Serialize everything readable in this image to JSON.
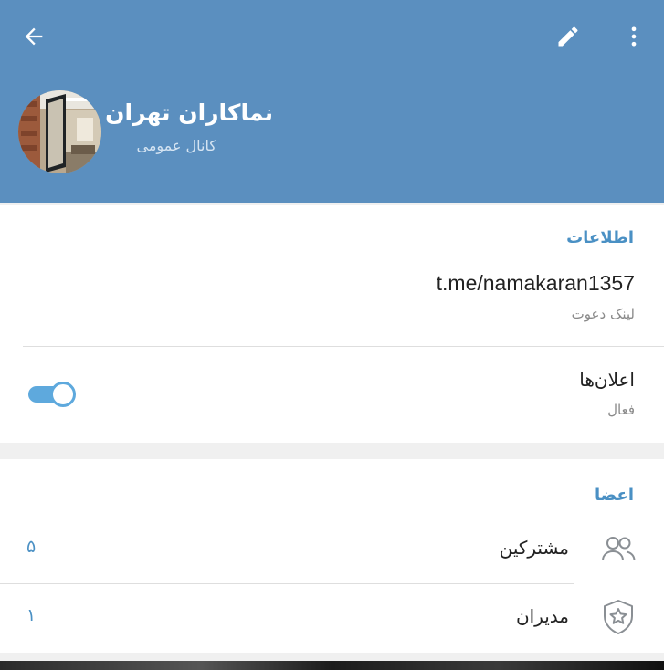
{
  "header": {
    "channel_title": "نماکاران تهران",
    "channel_subtitle": "کانال عمومی",
    "back_icon": "arrow-left-icon",
    "edit_icon": "pencil-icon",
    "more_icon": "more-vertical-icon",
    "background_color": "#5b8fbf"
  },
  "info_section": {
    "title": "اطلاعات",
    "invite_link": "t.me/namakaran1357",
    "invite_link_caption": "لینک دعوت",
    "notifications_label": "اعلان‌ها",
    "notifications_status": "فعال",
    "notifications_enabled": true
  },
  "members_section": {
    "title": "اعضا",
    "rows": [
      {
        "label": "مشترکین",
        "count": "۵",
        "icon": "users-icon"
      },
      {
        "label": "مدیران",
        "count": "۱",
        "icon": "admin-shield-star-icon"
      }
    ]
  },
  "colors": {
    "accent": "#4a90c4",
    "toggle_on": "#5ea9dd"
  }
}
